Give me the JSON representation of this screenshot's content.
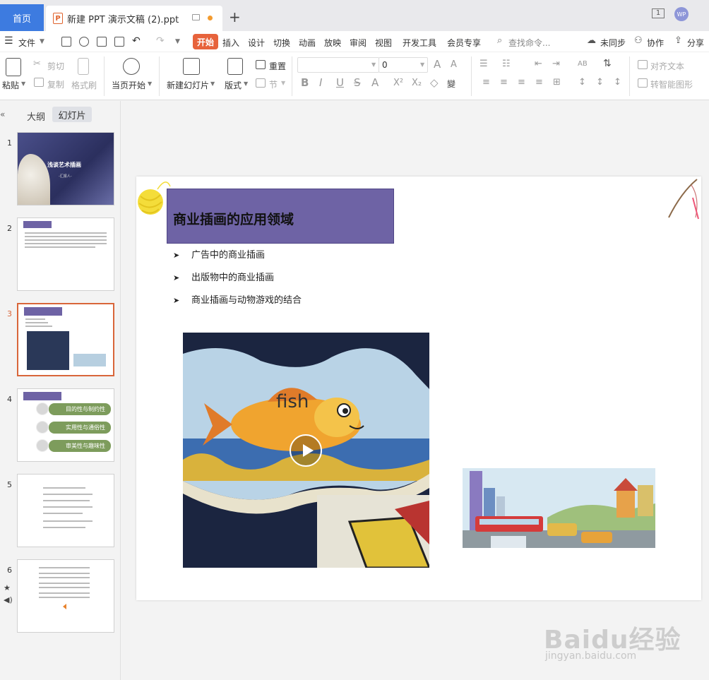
{
  "titlebar": {
    "home_tab": "首页",
    "doc_tab_icon": "P",
    "doc_tab_title": "新建 PPT 演示文稿 (2).ppt",
    "new_tab": "+",
    "window_count": "1",
    "avatar_text": "WP"
  },
  "menu": {
    "file": "文件",
    "tabs": [
      "开始",
      "插入",
      "设计",
      "切换",
      "动画",
      "放映",
      "审阅",
      "视图",
      "开发工具",
      "会员专享"
    ],
    "search_placeholder": "查找命令...",
    "sync": "未同步",
    "collab": "协作",
    "share": "分享"
  },
  "ribbon": {
    "paste": "粘贴",
    "cut": "剪切",
    "copy": "复制",
    "format_painter": "格式刷",
    "play_from_current": "当页开始",
    "new_slide": "新建幻灯片",
    "layout": "版式",
    "reset": "重置",
    "section": "节",
    "font_size_value": "0",
    "align_text": "对齐文本",
    "smart_art": "转智能图形"
  },
  "left_panel": {
    "outline_tab": "大纲",
    "slides_tab": "幻灯片",
    "slide_numbers": [
      "1",
      "2",
      "3",
      "4",
      "5",
      "6"
    ],
    "selected_slide": 3,
    "thumb1_title": "浅谈艺术插画",
    "thumb1_sub": "-汇报人-",
    "thumb4_items": [
      "目的性与制约性",
      "实用性与通俗性",
      "审美性与趣味性"
    ]
  },
  "slide": {
    "title": "商业插画的应用领域",
    "bullets": [
      "广告中的商业插画",
      "出版物中的商业插画",
      "商业插画与动物游戏的结合"
    ],
    "video_caption": "fish"
  },
  "watermark": {
    "logo": "Baidu经验",
    "url": "jingyan.baidu.com"
  },
  "colors": {
    "accent_orange": "#e7633c",
    "home_blue": "#3d7be0",
    "title_box_purple": "#6e63a5"
  }
}
